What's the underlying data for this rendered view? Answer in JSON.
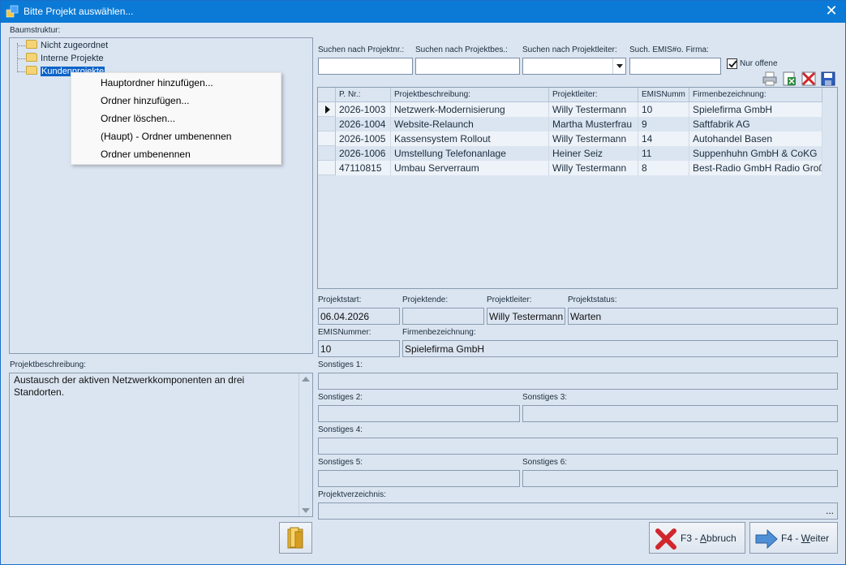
{
  "window": {
    "title": "Bitte Projekt auswählen...",
    "close_glyph": "✕"
  },
  "tree": {
    "label": "Baumstruktur:",
    "items": [
      {
        "label": "Nicht zugeordnet"
      },
      {
        "label": "Interne Projekte"
      },
      {
        "label": "Kundenprojekte",
        "selected": true
      }
    ]
  },
  "context_menu": {
    "items": [
      {
        "label": "Hauptordner hinzufügen..."
      },
      {
        "label": "Ordner hinzufügen..."
      },
      {
        "label": "Ordner löschen..."
      },
      {
        "label": "(Haupt) - Ordner umbenennen"
      },
      {
        "label": "Ordner umbenennen"
      }
    ]
  },
  "description": {
    "label": "Projektbeschreibung:",
    "text": "Austausch der aktiven Netzwerkkomponenten an drei Standorten."
  },
  "search": {
    "projektnr_label": "Suchen nach Projektnr.:",
    "projektbes_label": "Suchen nach Projektbes.:",
    "projektleiter_label": "Suchen nach Projektleiter:",
    "emis_label": "Such. EMIS#o. Firma:",
    "projektnr_value": "",
    "projektbes_value": "",
    "projektleiter_value": "",
    "emis_value": "",
    "nur_offene_label": "Nur offene",
    "nur_offene_checked": true
  },
  "toolbar": {
    "icons": [
      "printer-icon",
      "export-excel-icon",
      "delete-icon",
      "save-icon"
    ]
  },
  "table": {
    "headers": [
      "P. Nr.:",
      "Projektbeschreibung:",
      "Projektleiter:",
      "EMISNumm",
      "Firmenbezeichnung:"
    ],
    "rows": [
      {
        "nr": "2026-1003",
        "desc": "Netzwerk-Modernisierung",
        "leiter": "Willy Testermann",
        "emis": "10",
        "firma": "Spielefirma GmbH",
        "current": true
      },
      {
        "nr": "2026-1004",
        "desc": "Website-Relaunch",
        "leiter": "Martha Musterfrau",
        "emis": "9",
        "firma": "Saftfabrik AG"
      },
      {
        "nr": "2026-1005",
        "desc": "Kassensystem Rollout",
        "leiter": "Willy Testermann",
        "emis": "14",
        "firma": "Autohandel Basen"
      },
      {
        "nr": "2026-1006",
        "desc": "Umstellung Telefonanlage",
        "leiter": "Heiner Seiz",
        "emis": "11",
        "firma": "Suppenhuhn GmbH & CoKG"
      },
      {
        "nr": "47110815",
        "desc": "Umbau Serverraum",
        "leiter": "Willy Testermann",
        "emis": "8",
        "firma": "Best-Radio GmbH Radio Groß"
      }
    ]
  },
  "details": {
    "projektstart_label": "Projektstart:",
    "projektstart": "06.04.2026",
    "projektende_label": "Projektende:",
    "projektende": "",
    "projektleiter_label": "Projektleiter:",
    "projektleiter": "Willy Testermann",
    "projektstatus_label": "Projektstatus:",
    "projektstatus": "Warten",
    "emisnummer_label": "EMISNummer:",
    "emisnummer": "10",
    "firmenbezeichnung_label": "Firmenbezeichnung:",
    "firmenbezeichnung": "Spielefirma GmbH",
    "sonstiges1_label": "Sonstiges 1:",
    "sonstiges1": "",
    "sonstiges2_label": "Sonstiges 2:",
    "sonstiges2": "",
    "sonstiges3_label": "Sonstiges 3:",
    "sonstiges3": "",
    "sonstiges4_label": "Sonstiges 4:",
    "sonstiges4": "",
    "sonstiges5_label": "Sonstiges 5:",
    "sonstiges5": "",
    "sonstiges6_label": "Sonstiges 6:",
    "sonstiges6": "",
    "projektverzeichnis_label": "Projektverzeichnis:",
    "projektverzeichnis": "",
    "browse_label": "..."
  },
  "buttons": {
    "abbruch_prefix": "F3 - ",
    "abbruch_key": "A",
    "abbruch_rest": "bbruch",
    "weiter_prefix": "F4 - ",
    "weiter_key": "W",
    "weiter_rest": "eiter"
  },
  "colors": {
    "titlebar": "#0a7ad6",
    "selection": "#0a63c9",
    "background": "#dbe5f1"
  }
}
